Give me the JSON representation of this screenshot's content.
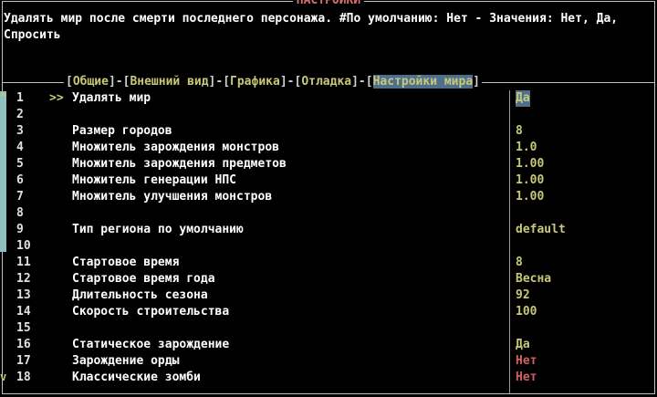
{
  "window_title": "НАСТРОЙКИ",
  "description": "Удалять мир после смерти последнего персонажа. #По умолчанию: Нет - Значения: Нет, Да, Спросить",
  "tabs": [
    {
      "label": "Общие",
      "active": false
    },
    {
      "label": "Внешний вид",
      "active": false
    },
    {
      "label": "Графика",
      "active": false
    },
    {
      "label": "Отладка",
      "active": false
    },
    {
      "label": "Настройки мира",
      "active": true
    }
  ],
  "scroll": {
    "up_icon": "^",
    "down_icon": "v"
  },
  "cursor": ">>",
  "rows": [
    {
      "num": "1",
      "label": "Удалять мир",
      "value": "Да",
      "color": "yellow",
      "selected": true
    },
    {
      "num": "2",
      "label": "",
      "value": "",
      "color": "yellow",
      "selected": false
    },
    {
      "num": "3",
      "label": "Размер городов",
      "value": "8",
      "color": "yellow",
      "selected": false
    },
    {
      "num": "4",
      "label": "Множитель зарождения монстров",
      "value": "1.0",
      "color": "yellow",
      "selected": false
    },
    {
      "num": "5",
      "label": "Множитель зарождения предметов",
      "value": "1.00",
      "color": "yellow",
      "selected": false
    },
    {
      "num": "6",
      "label": "Множитель генерации НПС",
      "value": "1.00",
      "color": "yellow",
      "selected": false
    },
    {
      "num": "7",
      "label": "Множитель улучшения монстров",
      "value": "1.00",
      "color": "yellow",
      "selected": false
    },
    {
      "num": "8",
      "label": "",
      "value": "",
      "color": "yellow",
      "selected": false
    },
    {
      "num": "9",
      "label": "Тип региона по умолчанию",
      "value": "default",
      "color": "yellow",
      "selected": false
    },
    {
      "num": "10",
      "label": "",
      "value": "",
      "color": "yellow",
      "selected": false
    },
    {
      "num": "11",
      "label": "Стартовое время",
      "value": "8",
      "color": "yellow",
      "selected": false
    },
    {
      "num": "12",
      "label": "Стартовое время года",
      "value": "Весна",
      "color": "yellow",
      "selected": false
    },
    {
      "num": "13",
      "label": "Длительность сезона",
      "value": "92",
      "color": "yellow",
      "selected": false
    },
    {
      "num": "14",
      "label": "Скорость строительства",
      "value": "100",
      "color": "yellow",
      "selected": false
    },
    {
      "num": "15",
      "label": "",
      "value": "",
      "color": "yellow",
      "selected": false
    },
    {
      "num": "16",
      "label": "Статическое зарождение",
      "value": "Да",
      "color": "yellow",
      "selected": false
    },
    {
      "num": "17",
      "label": "Зарождение орды",
      "value": "Нет",
      "color": "red",
      "selected": false
    },
    {
      "num": "18",
      "label": "Классические зомби",
      "value": "Нет",
      "color": "red",
      "selected": false
    }
  ]
}
